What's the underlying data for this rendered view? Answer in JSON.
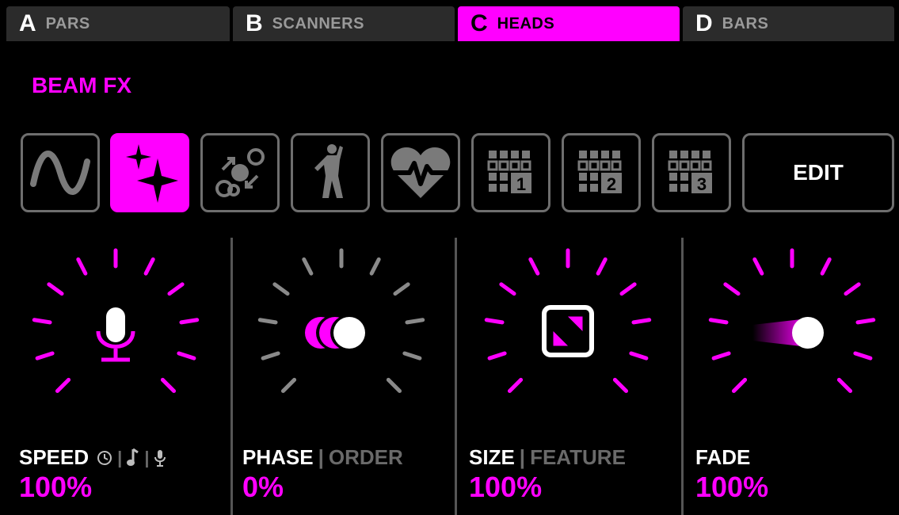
{
  "tabs": [
    {
      "letter": "A",
      "name": "PARS",
      "active": false
    },
    {
      "letter": "B",
      "name": "SCANNERS",
      "active": false
    },
    {
      "letter": "C",
      "name": "HEADS",
      "active": true
    },
    {
      "letter": "D",
      "name": "BARS",
      "active": false
    }
  ],
  "section_title": "BEAM FX",
  "fx_buttons": [
    {
      "icon": "sine-wave-icon",
      "active": false
    },
    {
      "icon": "sparkle-icon",
      "active": true
    },
    {
      "icon": "move-dots-icon",
      "active": false
    },
    {
      "icon": "dancer-icon",
      "active": false
    },
    {
      "icon": "heartbeat-icon",
      "active": false
    },
    {
      "icon": "grid-preset-1-icon",
      "number": "1",
      "active": false
    },
    {
      "icon": "grid-preset-2-icon",
      "number": "2",
      "active": false
    },
    {
      "icon": "grid-preset-3-icon",
      "number": "3",
      "active": false
    },
    {
      "label": "EDIT",
      "active": false
    }
  ],
  "params": {
    "speed": {
      "label": "SPEED",
      "value": "100%",
      "modes": [
        "clock-icon",
        "music-note-icon",
        "mic-icon"
      ]
    },
    "phase": {
      "label": "PHASE",
      "sep": "|",
      "alt": "ORDER",
      "value": "0%"
    },
    "size": {
      "label": "SIZE",
      "sep": "|",
      "alt": "FEATURE",
      "value": "100%"
    },
    "fade": {
      "label": "FADE",
      "value": "100%"
    }
  },
  "colors": {
    "accent": "#ff00ff",
    "inactive": "#6e6e6e",
    "tab_bg": "#2b2b2b"
  }
}
